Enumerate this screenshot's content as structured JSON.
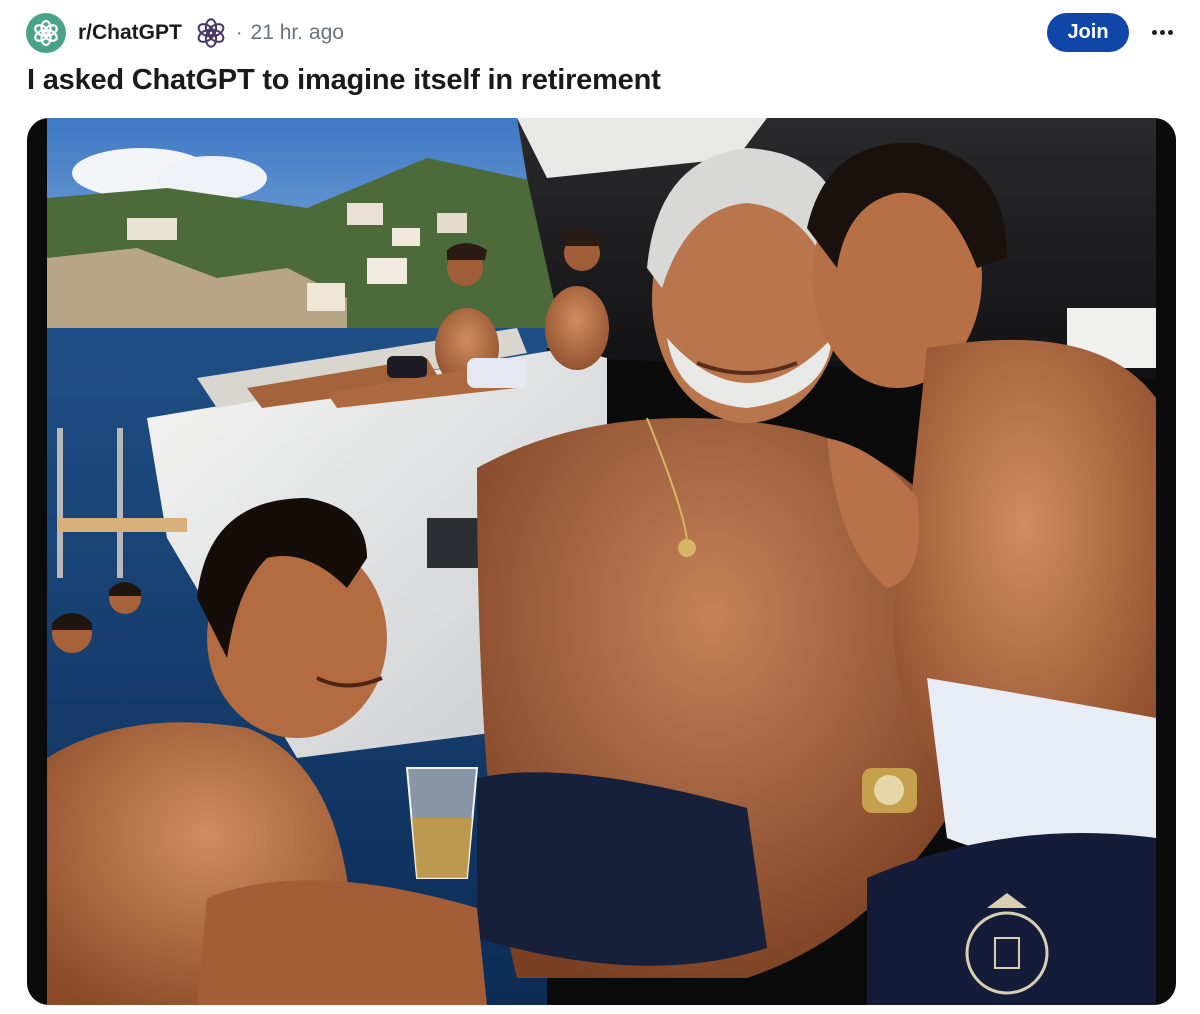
{
  "post": {
    "subreddit": "r/ChatGPT",
    "separator": "·",
    "time_ago": "21 hr. ago",
    "join_label": "Join",
    "title": "I asked ChatGPT to imagine itself in retirement"
  },
  "icons": {
    "subreddit_avatar": "openai-logo-icon",
    "user_flair": "openai-logo-icon",
    "more": "ellipsis-icon"
  },
  "colors": {
    "avatar_bg": "#4aa389",
    "join_bg": "#0f46a8",
    "meta_text": "#6c7378",
    "title_text": "#1a1a1b"
  },
  "media": {
    "type": "image",
    "alt": "AI-generated photo of a silver-haired tanned man on a yacht surrounded by shirtless young men"
  }
}
